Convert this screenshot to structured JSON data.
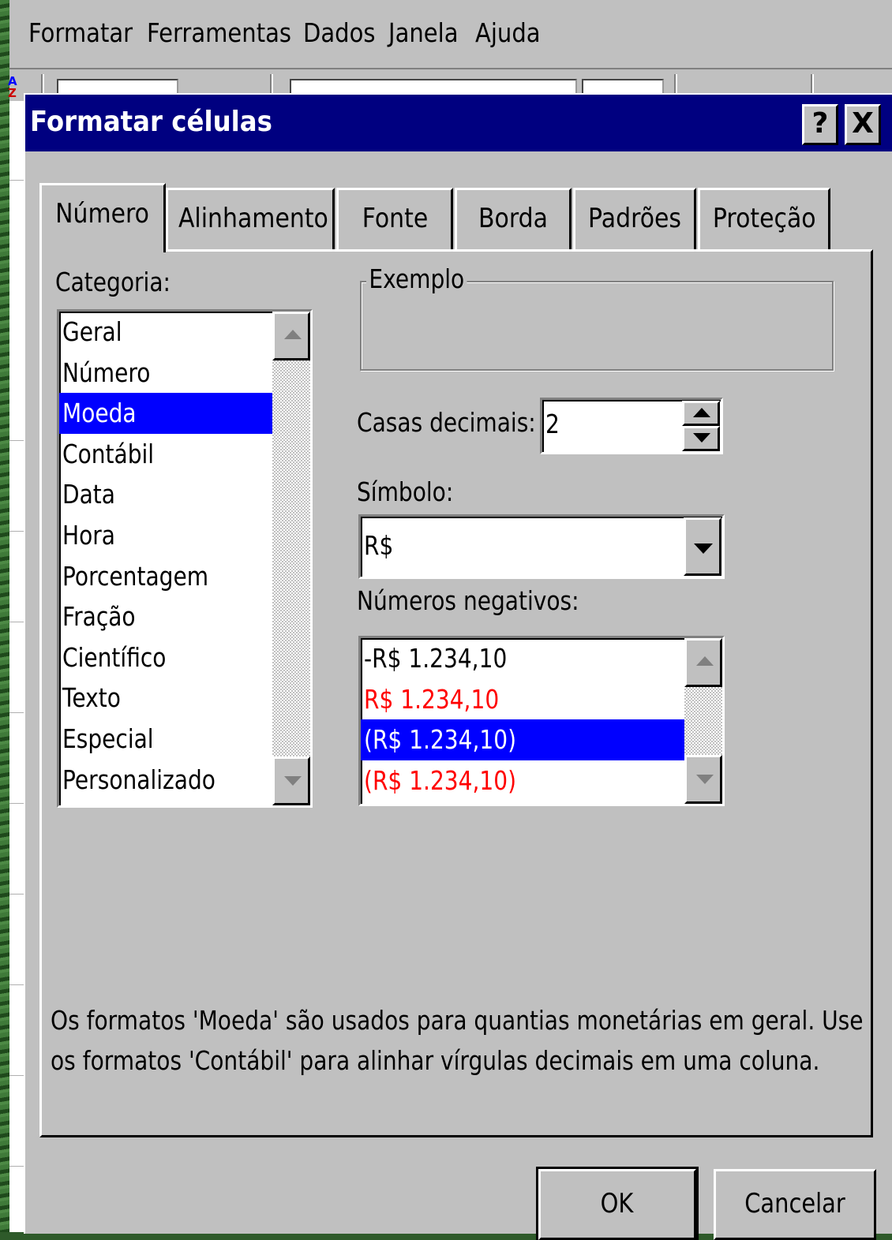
{
  "menubar": {
    "items": [
      "Formatar",
      "Ferramentas",
      "Dados",
      "Janela",
      "Ajuda"
    ]
  },
  "dialog": {
    "title": "Formatar células",
    "help_button": "?",
    "close_button": "X",
    "tabs": [
      "Número",
      "Alinhamento",
      "Fonte",
      "Borda",
      "Padrões",
      "Proteção"
    ],
    "active_tab": "Número",
    "category": {
      "label": "Categoria:",
      "items": [
        "Geral",
        "Número",
        "Moeda",
        "Contábil",
        "Data",
        "Hora",
        "Porcentagem",
        "Fração",
        "Científico",
        "Texto",
        "Especial",
        "Personalizado"
      ],
      "selected": "Moeda"
    },
    "example": {
      "label": "Exemplo",
      "value": ""
    },
    "decimal_places": {
      "label": "Casas decimais:",
      "value": "2"
    },
    "symbol": {
      "label": "Símbolo:",
      "value": "R$"
    },
    "negative_numbers": {
      "label": "Números negativos:",
      "items": [
        {
          "text": "-R$ 1.234,10",
          "color": "#000000"
        },
        {
          "text": "R$ 1.234,10",
          "color": "#ff0000"
        },
        {
          "text": "(R$ 1.234,10)",
          "color": "#000000"
        },
        {
          "text": "(R$ 1.234,10)",
          "color": "#ff0000"
        }
      ],
      "selected_index": 2
    },
    "description_lines": [
      "Os formatos 'Moeda' são usados para quantias monetárias em geral. Use",
      "os formatos 'Contábil' para alinhar vírgulas decimais em uma coluna."
    ],
    "ok_button": "OK",
    "cancel_button": "Cancelar"
  },
  "colors": {
    "titlebar": "#000080",
    "selection": "#0000ff",
    "dialog_face": "#c0c0c0",
    "negative_red": "#ff0000"
  }
}
